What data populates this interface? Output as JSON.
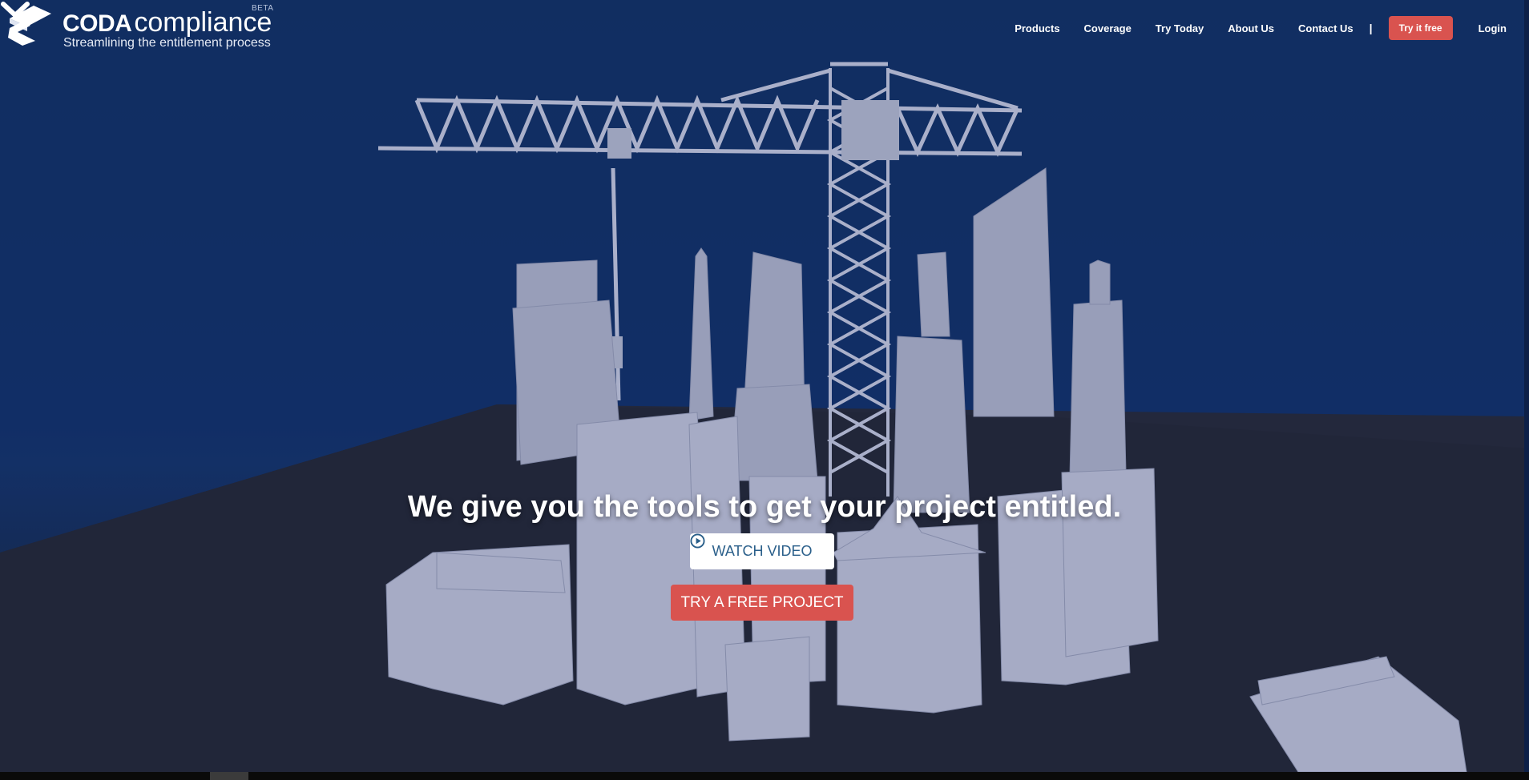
{
  "brand": {
    "name_bold": "CODA",
    "name_light": "compliance",
    "beta": "BETA",
    "tagline": "Streamlining the entitlement process",
    "logo_icon": "coda-logo-mark"
  },
  "nav": {
    "items": [
      "Products",
      "Coverage",
      "Try Today",
      "About Us",
      "Contact Us"
    ],
    "separator": "|",
    "cta": "Try it free",
    "login": "Login"
  },
  "hero": {
    "headline": "We give you the tools to get your project entitled.",
    "watch_video": "WATCH VIDEO",
    "watch_icon": "play-circle-icon",
    "try_free": "TRY A FREE PROJECT",
    "scroll_icon": "chevron-down-icon"
  },
  "colors": {
    "sky": "#12306a",
    "ground": "#22283a",
    "building": "#a9afc8",
    "accent_red": "#d9534f",
    "watch_text": "#2a5f8a"
  }
}
